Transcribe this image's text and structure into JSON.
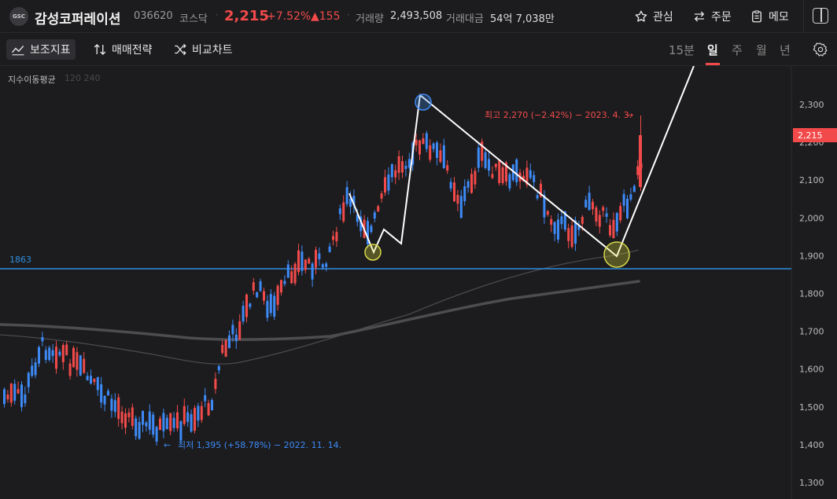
{
  "header": {
    "logo_text": "GSC",
    "stock_name": "감성코퍼레이션",
    "stock_code": "036620",
    "market": "코스닥",
    "price": "2,215",
    "change_pct": "+7.52%",
    "change_abs": "▲155",
    "volume_label": "거래량",
    "volume_value": "2,493,508",
    "amount_label": "거래대금",
    "amount_value": "54억 7,038만",
    "watch_label": "관심",
    "order_label": "주문",
    "memo_label": "메모"
  },
  "toolbar": {
    "indicator_label": "보조지표",
    "strategy_label": "매매전략",
    "compare_label": "비교차트",
    "periods": [
      "15분",
      "일",
      "주",
      "월",
      "년"
    ],
    "selected_period": "일"
  },
  "indicator": {
    "label": "지수이동평균",
    "params": "120 240"
  },
  "chart_data": {
    "type": "candlestick",
    "y_ticks": [
      "2,300",
      "2,200",
      "2,100",
      "2,000",
      "1,900",
      "1,800",
      "1,700",
      "1,600",
      "1,500",
      "1,400",
      "1,300"
    ],
    "ylim": [
      1290,
      2390
    ],
    "current_price_label": "2,215",
    "current_price": 2215,
    "horizontal_line_label": "1863",
    "horizontal_line_value": 1863,
    "high_annotation": "최고 2,270 (−2.42%) − 2023. 4. 3.",
    "low_annotation": "최저 1,395 (+58.78%) − 2022. 11. 14.",
    "colors": {
      "up": "#f24a4a",
      "down": "#3d8af7",
      "hline": "#2f8ee0",
      "ema": "#5a5a5a"
    }
  }
}
